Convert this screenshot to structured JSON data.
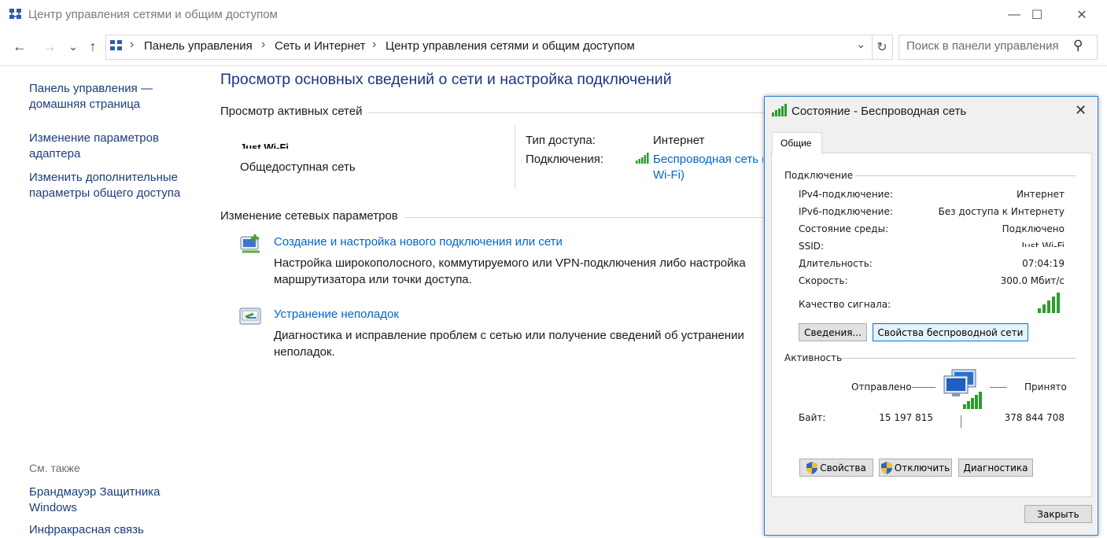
{
  "window": {
    "title": "Центр управления сетями и общим доступом",
    "controls": {
      "minimize": "—",
      "maximize": "☐",
      "close": "✕"
    }
  },
  "nav": {
    "back": "←",
    "forward": "→",
    "recent": "⌄",
    "up": "↑",
    "breadcrumbs": [
      "Панель управления",
      "Сеть и Интернет",
      "Центр управления сетями и общим доступом"
    ],
    "separator": "›",
    "dropdown": "⌄",
    "refresh": "↻",
    "search_placeholder": "Поиск в панели управления",
    "search_icon": "⚲"
  },
  "sidebar": {
    "links": [
      "Панель управления — домашняя страница",
      "Изменение параметров адаптера",
      "Изменить дополнительные параметры общего доступа"
    ],
    "see_also_title": "См. также",
    "see_also": [
      "Брандмауэр Защитника Windows",
      "Инфракрасная связь"
    ]
  },
  "main": {
    "title": "Просмотр основных сведений о сети и настройка подключений",
    "active_networks_head": "Просмотр активных сетей",
    "network_name": "Just Wi-Fi",
    "network_type": "Общедоступная сеть",
    "access_type_label": "Тип доступа:",
    "access_type_value": "Интернет",
    "connections_label": "Подключения:",
    "connections_value_1": "Беспроводная сеть (",
    "connections_value_2": "Wi-Fi)",
    "change_settings_head": "Изменение сетевых параметров",
    "tasks": [
      {
        "title": "Создание и настройка нового подключения или сети",
        "desc": "Настройка широкополосного, коммутируемого или VPN-подключения либо настройка маршрутизатора или точки доступа."
      },
      {
        "title": "Устранение неполадок",
        "desc": "Диагностика и исправление проблем с сетью или получение сведений об устранении неполадок."
      }
    ]
  },
  "dialog": {
    "title": "Состояние - Беспроводная сеть",
    "close": "✕",
    "tab": "Общие",
    "connection_group": "Подключение",
    "rows": [
      {
        "label": "IPv4-подключение:",
        "value": "Интернет"
      },
      {
        "label": "IPv6-подключение:",
        "value": "Без доступа к Интернету"
      },
      {
        "label": "Состояние среды:",
        "value": "Подключено"
      },
      {
        "label": "SSID:",
        "value": "Just Wi-Fi"
      },
      {
        "label": "Длительность:",
        "value": "07:04:19"
      },
      {
        "label": "Скорость:",
        "value": "300.0 Мбит/с"
      }
    ],
    "signal_label": "Качество сигнала:",
    "signal_bars": 5,
    "details_button": "Сведения...",
    "wireless_props_button": "Свойства беспроводной сети",
    "activity_group": "Активность",
    "sent_label": "Отправлено",
    "received_label": "Принято",
    "bytes_label": "Байт:",
    "bytes_sent": "15 197 815",
    "bytes_received": "378 844 708",
    "properties_button": "Свойства",
    "disable_button": "Отключить",
    "diagnose_button": "Диагностика",
    "close_button": "Закрыть",
    "accent_color": "#0078d7",
    "signal_color": "#2e9b2e"
  }
}
